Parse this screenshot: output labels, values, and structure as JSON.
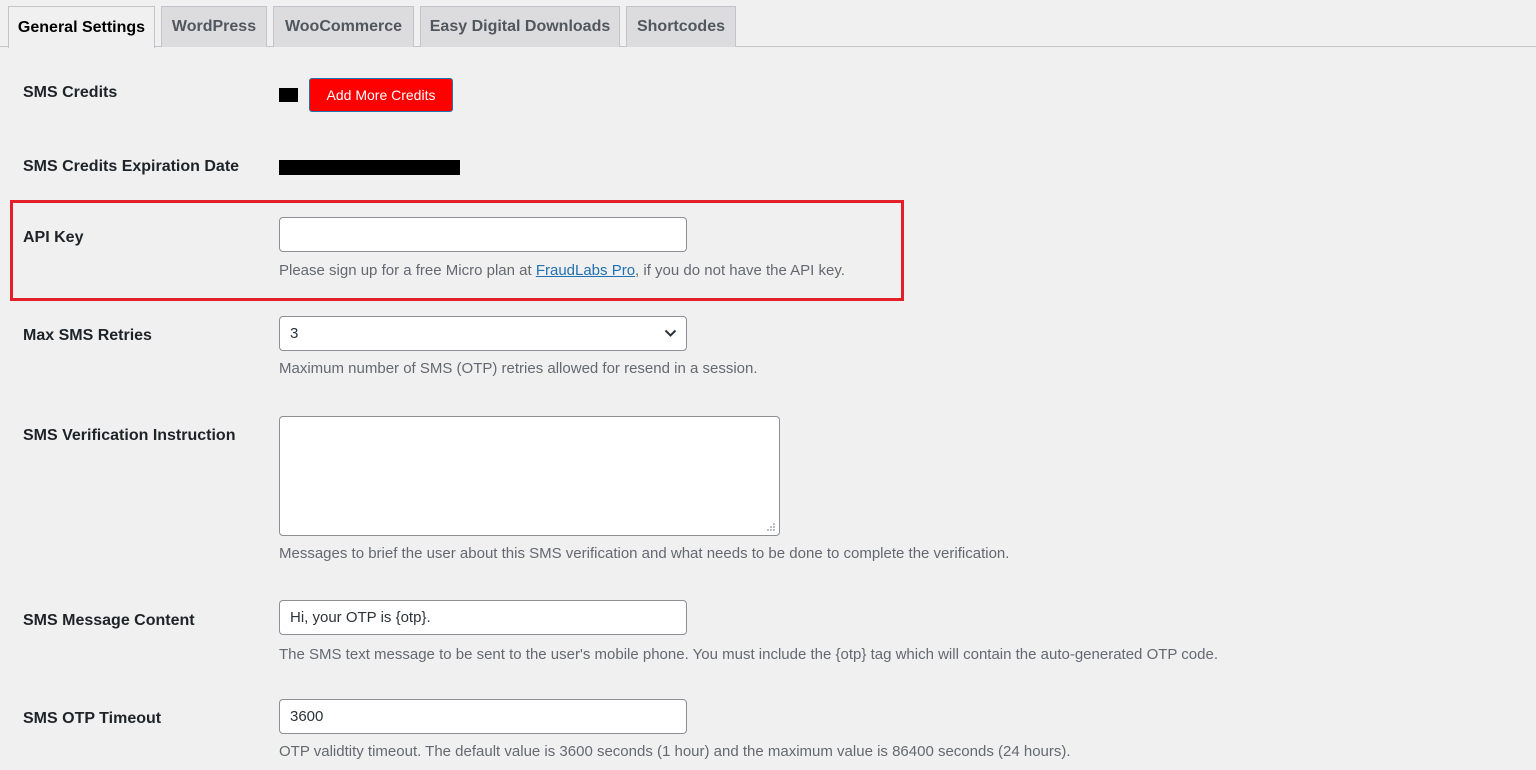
{
  "tabs": [
    {
      "label": "General Settings",
      "active": true
    },
    {
      "label": "WordPress"
    },
    {
      "label": "WooCommerce"
    },
    {
      "label": "Easy Digital Downloads"
    },
    {
      "label": "Shortcodes"
    }
  ],
  "sms_credits": {
    "label": "SMS Credits",
    "button_label": "Add More Credits",
    "button_color": "#ff0000"
  },
  "expiration": {
    "label": "SMS Credits Expiration Date"
  },
  "api_key": {
    "label": "API Key",
    "value": "",
    "help_prefix": "Please sign up for a free Micro plan at ",
    "help_link": "FraudLabs Pro",
    "help_suffix": ", if you do not have the API key.",
    "highlight_color": "#e3202a"
  },
  "max_retries": {
    "label": "Max SMS Retries",
    "selected": "3",
    "help": "Maximum number of SMS (OTP) retries allowed for resend in a session."
  },
  "instruction": {
    "label": "SMS Verification Instruction",
    "value": "",
    "help": "Messages to brief the user about this SMS verification and what needs to be done to complete the verification."
  },
  "message_content": {
    "label": "SMS Message Content",
    "value": "Hi, your OTP is {otp}.",
    "help": "The SMS text message to be sent to the user's mobile phone. You must include the {otp} tag which will contain the auto-generated OTP code."
  },
  "otp_timeout": {
    "label": "SMS OTP Timeout",
    "value": "3600",
    "help": "OTP validtity timeout. The default value is 3600 seconds (1 hour) and the maximum value is 86400 seconds (24 hours)."
  }
}
